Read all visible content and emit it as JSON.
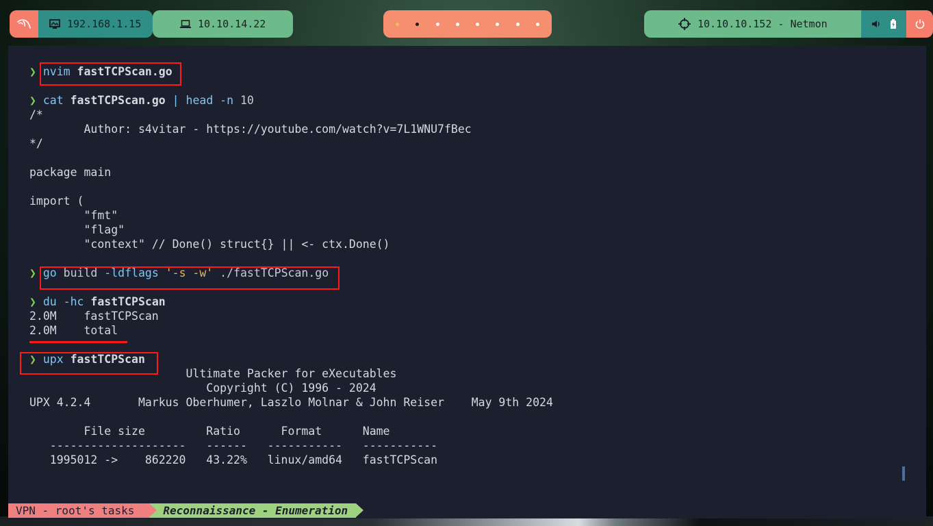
{
  "topbar": {
    "host_ip": "192.168.1.15",
    "vpn_ip": "10.10.14.22",
    "target": "10.10.10.152 - Netmon",
    "workspaces": 8,
    "active_workspace": 2
  },
  "terminal": {
    "prompt": "❯",
    "cmd1": {
      "cmd": "nvim",
      "arg": " fastTCPScan.go"
    },
    "cmd2": {
      "cmd": "cat",
      "arg1": " fastTCPScan.go ",
      "pipe": "|",
      "cmd_b": " head",
      "flag": " -n",
      "num": " 10"
    },
    "file_lines": [
      "/*",
      "        Author: s4vitar - https://youtube.com/watch?v=7L1WNU7fBec",
      "*/",
      "",
      "package main",
      "",
      "import (",
      "        \"fmt\"",
      "        \"flag\"",
      "        \"context\" // Done() struct{} || <- ctx.Done()"
    ],
    "cmd3": {
      "cmd": "go",
      "sub": " build",
      "flag": " -ldflags",
      "str": " '-s -w'",
      "arg": " ./fastTCPScan.go"
    },
    "cmd4": {
      "cmd": "du",
      "flag": " -hc",
      "arg": " fastTCPScan"
    },
    "du_output": [
      "2.0M    fastTCPScan",
      "2.0M    total"
    ],
    "cmd5": {
      "cmd": "upx",
      "arg": " fastTCPScan"
    },
    "upx_output": [
      "                       Ultimate Packer for eXecutables",
      "                          Copyright (C) 1996 - 2024",
      "UPX 4.2.4       Markus Oberhumer, Laszlo Molnar & John Reiser    May 9th 2024",
      "",
      "        File size         Ratio      Format      Name",
      "   --------------------   ------   -----------   -----------",
      "   1995012 ->    862220   43.22%   linux/amd64   fastTCPScan"
    ]
  },
  "statusbar": {
    "session": "VPN - root's tasks",
    "window": "Reconnaissance - Enumeration"
  },
  "colors": {
    "highlight": "#ff1a1a",
    "prompt": "#7fd05a",
    "command": "#7fc6f5",
    "string": "#f2b34a"
  }
}
